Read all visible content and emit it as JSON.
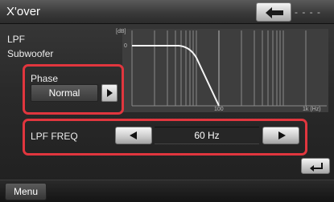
{
  "header": {
    "title": "X'over",
    "status_text": "- - - -"
  },
  "filter": {
    "line1": "LPF",
    "line2": "Subwoofer"
  },
  "graph": {
    "db_label": "[dB]",
    "zero_label": "0",
    "freq_label_100": "100",
    "freq_label_1k": "1k (Hz)"
  },
  "phase": {
    "label": "Phase",
    "value": "Normal"
  },
  "lpf_freq": {
    "label": "LPF FREQ",
    "value": "60 Hz"
  },
  "footer": {
    "menu_label": "Menu"
  },
  "colors": {
    "highlight": "#e1363e",
    "background": "#2a2a2a",
    "button": "#d8d8d8"
  },
  "icons": {
    "back": "back-arrow-icon",
    "return": "return-icon",
    "next": "triangle-right-icon",
    "prev": "triangle-left-icon"
  }
}
